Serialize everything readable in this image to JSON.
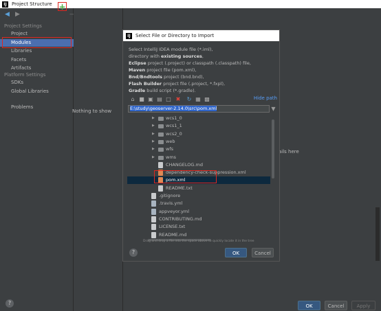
{
  "window": {
    "title": "Project Structure"
  },
  "nav": {
    "project_settings_header": "Project Settings",
    "project_settings": [
      "Project",
      "Modules",
      "Libraries",
      "Facets",
      "Artifacts"
    ],
    "platform_settings_header": "Platform Settings",
    "platform_settings": [
      "SDKs",
      "Global Libraries"
    ],
    "problems": "Problems",
    "selected": "Modules"
  },
  "middle": {
    "empty_text": "Nothing to show"
  },
  "right": {
    "details_text": "ails here"
  },
  "footer": {
    "ok": "OK",
    "cancel": "Cancel",
    "apply": "Apply"
  },
  "dialog": {
    "title": "Select File or Directory to Import",
    "description": [
      {
        "bold": "",
        "text": "Select IntelliJ IDEA module file (*.iml),"
      },
      {
        "bold": "",
        "text": "directory with ",
        "bold2": "existing sources",
        "tail": ","
      },
      {
        "bold": "Eclipse",
        "text": " project (.project) or classpath (.classpath) file,"
      },
      {
        "bold": "Maven",
        "text": " project file (pom.xml),"
      },
      {
        "bold": "Bnd/Bndtools",
        "text": " project (bnd.bnd),"
      },
      {
        "bold": "Flash Builder",
        "text": " project file (.project, *.fxpl),"
      },
      {
        "bold": "Gradle",
        "text": " build script (*.gradle)."
      }
    ],
    "hide_path": "Hide path",
    "path": "E:\\study\\geoserver-2.14.0\\src\\pom.xml",
    "tree": [
      {
        "type": "folder",
        "name": "wcs1_0",
        "level": 3,
        "expandable": true
      },
      {
        "type": "folder",
        "name": "wcs1_1",
        "level": 3,
        "expandable": true
      },
      {
        "type": "folder",
        "name": "wcs2_0",
        "level": 3,
        "expandable": true
      },
      {
        "type": "folder",
        "name": "web",
        "level": 3,
        "expandable": true
      },
      {
        "type": "folder",
        "name": "wfs",
        "level": 3,
        "expandable": true
      },
      {
        "type": "folder",
        "name": "wms",
        "level": 3,
        "expandable": true
      },
      {
        "type": "md",
        "name": "CHANGELOG.md",
        "level": 3
      },
      {
        "type": "xml",
        "name": "dependency-check-suppression.xml",
        "level": 3
      },
      {
        "type": "xml",
        "name": "pom.xml",
        "level": 3,
        "selected": true
      },
      {
        "type": "txt",
        "name": "README.txt",
        "level": 3
      },
      {
        "type": "file",
        "name": ".gitignore",
        "level": 2
      },
      {
        "type": "yml",
        "name": ".travis.yml",
        "level": 2
      },
      {
        "type": "yml",
        "name": "appveyor.yml",
        "level": 2
      },
      {
        "type": "md",
        "name": "CONTRIBUTING.md",
        "level": 2
      },
      {
        "type": "txt",
        "name": "LICENSE.txt",
        "level": 2
      },
      {
        "type": "md",
        "name": "README.md",
        "level": 2
      }
    ],
    "drag_hint": "Drag and drop a file into the space above to quickly locate it in the tree",
    "ok": "OK",
    "cancel": "Cancel"
  },
  "colors": {
    "selection": "#4b6eaf",
    "primary_button": "#365880",
    "annotation": "#e0271f",
    "link": "#589df6"
  }
}
